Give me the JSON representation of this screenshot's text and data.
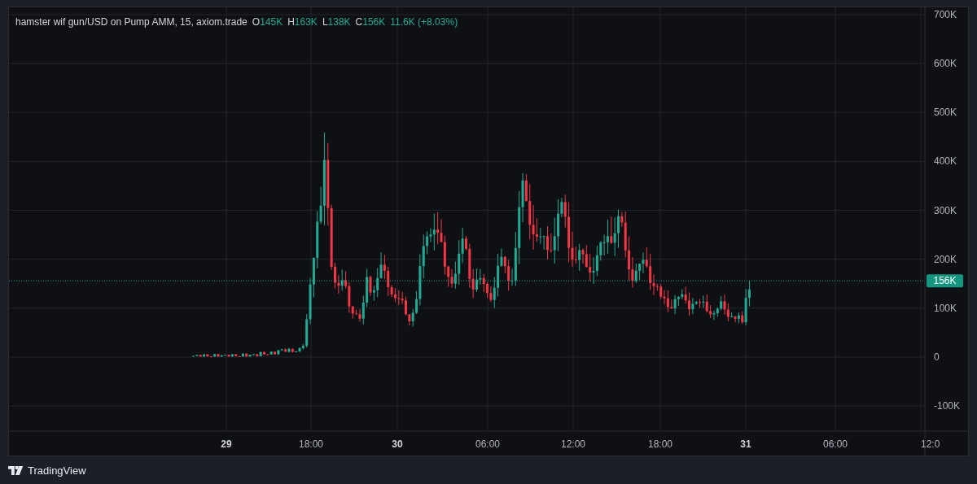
{
  "legend": {
    "symbol": "hamster wif gun/USD on Pump AMM, 15, axiom.trade",
    "ohlc": [
      {
        "label": "O",
        "value": "145K"
      },
      {
        "label": "H",
        "value": "163K"
      },
      {
        "label": "L",
        "value": "138K"
      },
      {
        "label": "C",
        "value": "156K"
      }
    ],
    "change": "11.6K (+8.03%)"
  },
  "price_axis": {
    "ticks": [
      "700K",
      "600K",
      "500K",
      "400K",
      "300K",
      "200K",
      "100K",
      "0",
      "-100K"
    ],
    "last_price": "156K"
  },
  "time_axis": {
    "ticks": [
      {
        "label": "29",
        "kind": "day"
      },
      {
        "label": "18:00",
        "kind": "time"
      },
      {
        "label": "30",
        "kind": "day"
      },
      {
        "label": "06:00",
        "kind": "time"
      },
      {
        "label": "12:00",
        "kind": "time"
      },
      {
        "label": "18:00",
        "kind": "time"
      },
      {
        "label": "31",
        "kind": "day"
      },
      {
        "label": "06:00",
        "kind": "time"
      },
      {
        "label": "12:0",
        "kind": "time"
      }
    ]
  },
  "footer": {
    "brand": "TradingView"
  }
}
